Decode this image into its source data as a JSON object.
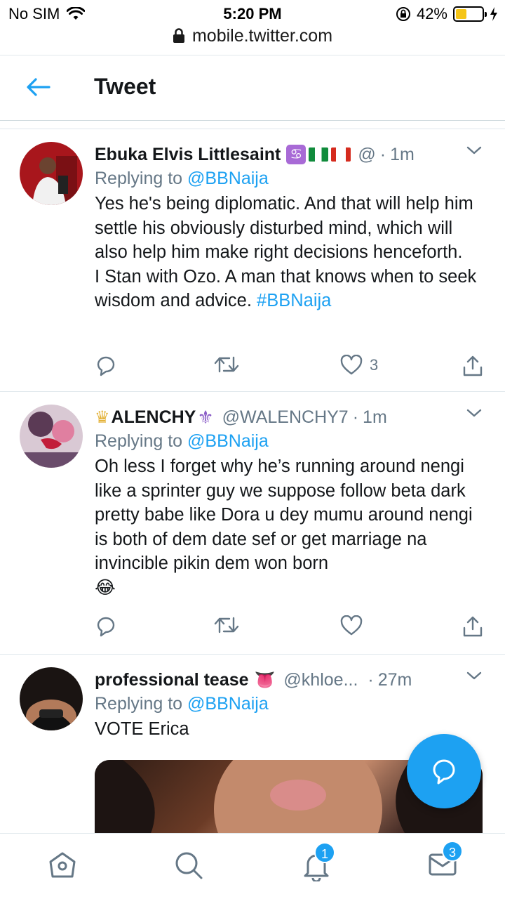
{
  "status": {
    "carrier": "No SIM",
    "time": "5:20 PM",
    "battery": "42%",
    "battery_level": 0.42
  },
  "browser": {
    "url": "mobile.twitter.com"
  },
  "header": {
    "title": "Tweet"
  },
  "tweets": [
    {
      "name": "Ebuka Elvis Littlesaint",
      "handle": "@",
      "time": "1m",
      "replying_label": "Replying to",
      "replying_to": "@BBNaija",
      "text": "Yes he's being diplomatic. And that will help him settle his obviously disturbed mind, which will also help him make right decisions henceforth.\nI Stan with Ozo. A man that knows when to seek wisdom and advice. ",
      "hashtag": "#BBNaija",
      "likes": "3"
    },
    {
      "name": "ALENCHY",
      "handle": "@WALENCHY7",
      "time": "1m",
      "replying_label": "Replying to",
      "replying_to": "@BBNaija",
      "text": "Oh less I forget why he’s running around nengi like a sprinter guy we suppose follow beta dark pretty babe like Dora u dey mumu around nengi is both of dem date sef or get marriage na invincible pikin dem won born",
      "emoji": "😂"
    },
    {
      "name": "professional tease",
      "name_emoji": "👅",
      "handle": "@khloe...",
      "time": "27m",
      "replying_label": "Replying to",
      "replying_to": "@BBNaija",
      "text": "VOTE Erica"
    }
  ],
  "nav": {
    "notifications_badge": "1",
    "messages_badge": "3"
  },
  "colors": {
    "accent": "#1da1f2",
    "text": "#14171a",
    "muted": "#657786"
  }
}
